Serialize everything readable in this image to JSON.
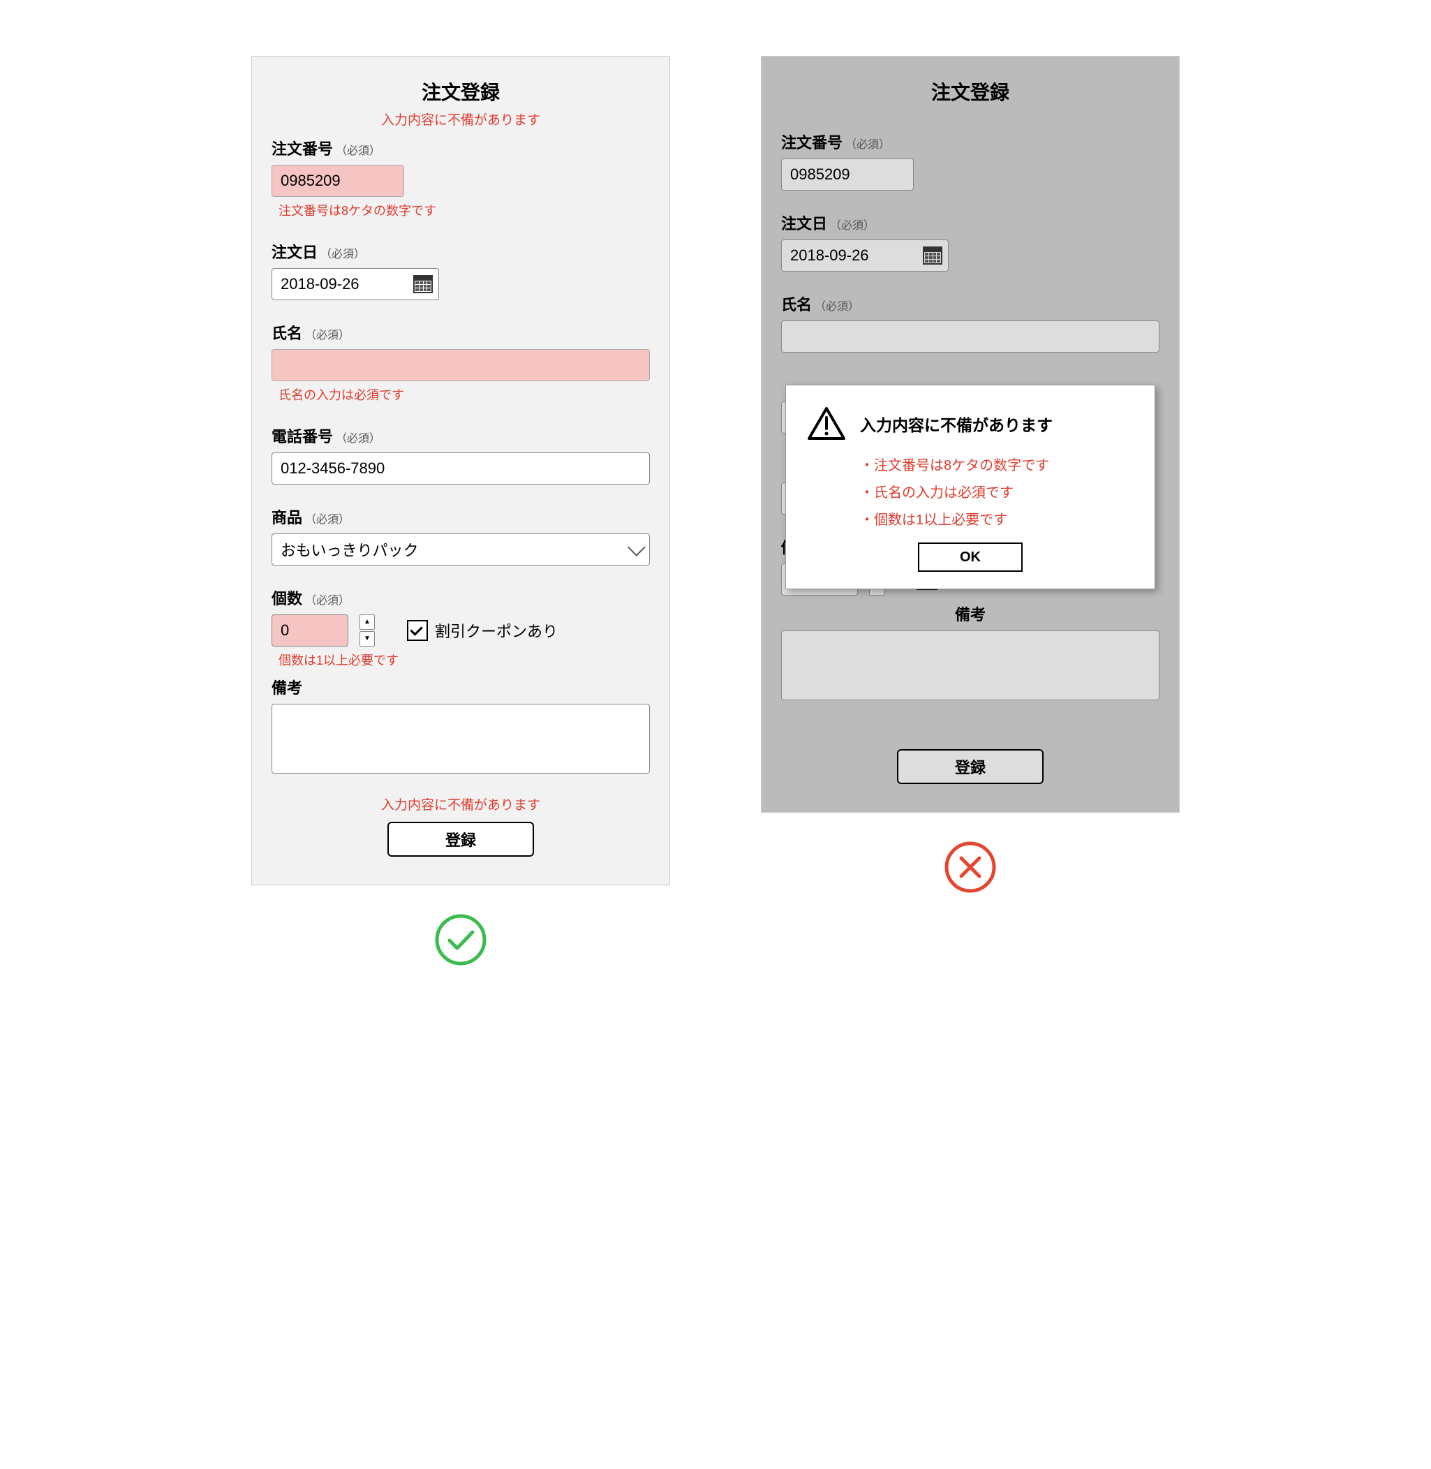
{
  "colors": {
    "error": "#e03b2e",
    "errorFieldBg": "#f6c5c3",
    "good": "#3bbb4c",
    "bad": "#e4462f"
  },
  "common": {
    "title": "注文登録",
    "errorSummary": "入力内容に不備があります",
    "requiredSuffix": "（必須）",
    "fields": {
      "orderNumber": {
        "label": "注文番号",
        "value": "0985209",
        "error": "注文番号は8ケタの数字です"
      },
      "orderDate": {
        "label": "注文日",
        "value": "2018-09-26"
      },
      "name": {
        "label": "氏名",
        "value": "",
        "error": "氏名の入力は必須です"
      },
      "phone": {
        "label": "電話番号",
        "value": "012-3456-7890"
      },
      "product": {
        "label": "商品",
        "value": "おもいっきりパック"
      },
      "quantity": {
        "label": "個数",
        "value": "0",
        "error": "個数は1以上必要です"
      },
      "coupon": {
        "label": "割引クーポンあり",
        "checked": true
      },
      "notes": {
        "label": "備考"
      }
    },
    "submitLabel": "登録"
  },
  "modal": {
    "title": "入力内容に不備があります",
    "items": [
      "・注文番号は8ケタの数字です",
      "・氏名の入力は必須です",
      "・個数は1以上必要です"
    ],
    "okLabel": "OK"
  }
}
